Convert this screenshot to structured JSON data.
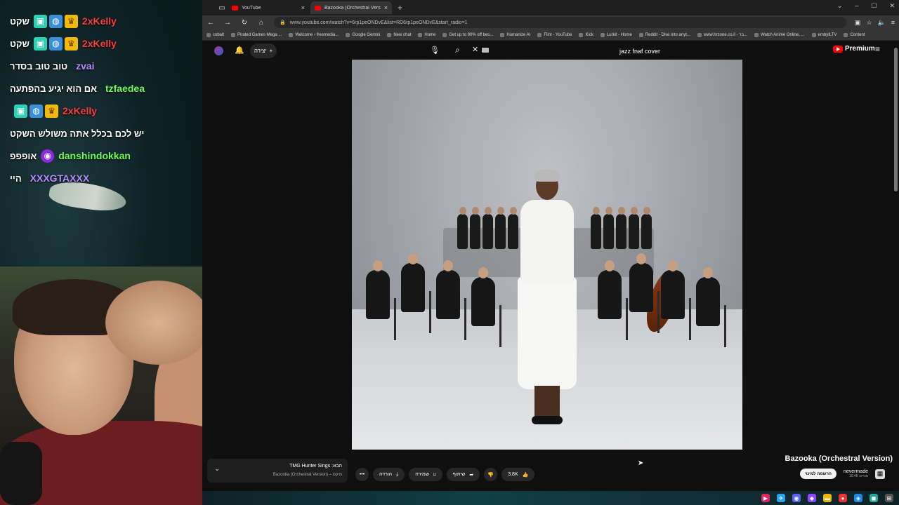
{
  "stream": {
    "chat": [
      {
        "user": "2xKelly",
        "color": "#ff3b3b",
        "badges": [
          "gift-icon",
          "globe-icon",
          "crown-icon"
        ],
        "message": "שקט"
      },
      {
        "user": "2xKelly",
        "color": "#ff3b3b",
        "badges": [
          "gift-icon",
          "globe-icon",
          "crown-icon"
        ],
        "message": "שקט"
      },
      {
        "user": "zvai",
        "color": "#b98dff",
        "badges": [],
        "message": "טוב טוב בסדר"
      },
      {
        "user": "tzfaedea",
        "color": "#6bff5a",
        "badges": [],
        "message": "אם הוא יגיע בהפתעה"
      },
      {
        "user": "2xKelly",
        "color": "#ff3b3b",
        "badges": [
          "gift-icon",
          "globe-icon",
          "crown-icon"
        ],
        "message": ""
      },
      {
        "user": "",
        "color": "#ffffff",
        "badges": [],
        "message": "יש לכם בכלל אתה משולש השקט"
      },
      {
        "user": "danshindokkan",
        "color": "#6bff5a",
        "badges": [
          "purple-icon"
        ],
        "message": "אופפפ"
      },
      {
        "user": "XXXGTAXXX",
        "color": "#b98dff",
        "badges": [],
        "message": "היי"
      }
    ]
  },
  "browser": {
    "tabs": [
      {
        "label": "YouTube",
        "active": false
      },
      {
        "label": "Bazooka (Orchestral Version) - Y",
        "active": true
      }
    ],
    "url": "www.youtube.com/watch?v=6rp1peONDvE&list=RD6rp1peONDvE&start_radio=1",
    "bookmarks": [
      "cobalt",
      "Pirated Games Mega ...",
      "Welcome › freemedia...",
      "Google Gemini",
      "New chat",
      "Home",
      "Get up to 90% off bes...",
      "Humanize AI",
      "Flint - YouTube",
      "Kick",
      "Lurkit - Home",
      "Reddit - Dive into anyt...",
      "www.hrzone.co.il - בר...",
      "Watch Anime Online, ...",
      "embyILTV",
      "Content"
    ]
  },
  "youtube": {
    "create_label": "יצירה",
    "search_value": "jazz fnaf cover",
    "logo_label": "Premium",
    "video_title": "Bazooka (Orchestral Version)",
    "channel_name": "nevermade",
    "channel_subs": "10.4K מנויים",
    "subscribe_label": "הרשמה למינוי",
    "like_count": "3.8K",
    "share_label": "שיתוף",
    "save_label": "שמירה",
    "download_label": "הורדה",
    "mini_title": "הבא: TMG Hunter Sings",
    "mini_sub": "מיקס – Bazooka (Orchestral Version)"
  },
  "colors": {
    "accent": "#ff0000",
    "bg": "#0f0f0f"
  }
}
